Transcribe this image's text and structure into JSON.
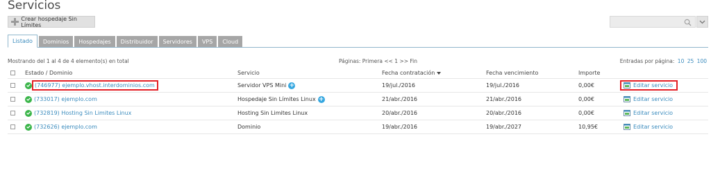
{
  "page": {
    "title": "Servicios"
  },
  "toolbar": {
    "create_label": "Crear hospedaje Sin Límites"
  },
  "tabs": [
    {
      "label": "Listado",
      "active": true
    },
    {
      "label": "Dominios"
    },
    {
      "label": "Hospedajes"
    },
    {
      "label": "Distribuidor"
    },
    {
      "label": "Servidores"
    },
    {
      "label": "VPS"
    },
    {
      "label": "Cloud"
    }
  ],
  "list_info": {
    "showing": "Mostrando del 1 al 4 de 4 elemento(s) en total",
    "pagination": "Páginas: Primera << 1 >> Fin",
    "entries_label": "Entradas por página:",
    "entries_options": [
      "10",
      "25",
      "100"
    ]
  },
  "table": {
    "headers": {
      "domain": "Estado / Dominio",
      "service": "Servicio",
      "contract": "Fecha contratación",
      "expiry": "Fecha vencimiento",
      "amount": "Importe"
    },
    "rows": [
      {
        "domain": "(746977) ejemplo.vhost.interdominios.com",
        "service": "Servidor VPS Mini",
        "contract": "19/jul./2016",
        "expiry": "19/jul./2016",
        "amount": "0,00€",
        "action": "Editar servicio"
      },
      {
        "domain": "(733017) ejemplo.com",
        "service": "Hospedaje Sin Límites Linux",
        "contract": "21/abr./2016",
        "expiry": "21/abr./2016",
        "amount": "0,00€",
        "action": "Editar servicio"
      },
      {
        "domain": "(732819) Hosting Sin Limites Linux",
        "service": "Hosting Sin Limites Linux",
        "contract": "20/abr./2016",
        "expiry": "20/abr./2016",
        "amount": "0,00€",
        "action": "Editar servicio"
      },
      {
        "domain": "(732626) ejemplo.com",
        "service": "Dominio",
        "contract": "19/abr./2016",
        "expiry": "19/abr./2027",
        "amount": "10,95€",
        "action": "Editar servicio"
      }
    ]
  },
  "colors": {
    "link": "#3a8bbd",
    "highlight": "#e31e24",
    "ok": "#3bb54a",
    "info": "#35a7e0"
  }
}
